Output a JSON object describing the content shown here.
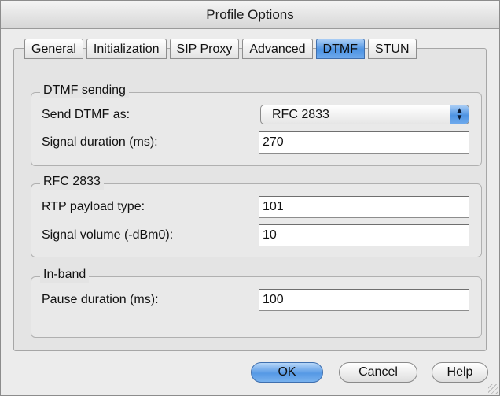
{
  "window": {
    "title": "Profile Options"
  },
  "tabs": [
    {
      "label": "General",
      "active": false
    },
    {
      "label": "Initialization",
      "active": false
    },
    {
      "label": "SIP Proxy",
      "active": false
    },
    {
      "label": "Advanced",
      "active": false
    },
    {
      "label": "DTMF",
      "active": true
    },
    {
      "label": "STUN",
      "active": false
    }
  ],
  "dtmf_sending": {
    "heading": "DTMF sending",
    "send_as_label": "Send DTMF as:",
    "send_as_value": "RFC 2833",
    "signal_duration_label": "Signal duration (ms):",
    "signal_duration_value": "270"
  },
  "rfc2833": {
    "heading": "RFC 2833",
    "payload_type_label": "RTP payload type:",
    "payload_type_value": "101",
    "signal_volume_label": "Signal volume (-dBm0):",
    "signal_volume_value": "10"
  },
  "in_band": {
    "heading": "In-band",
    "pause_duration_label": "Pause duration (ms):",
    "pause_duration_value": "100"
  },
  "buttons": {
    "ok": "OK",
    "cancel": "Cancel",
    "help": "Help"
  },
  "icons": {
    "popup": "up-down-arrows-icon"
  },
  "colors": {
    "accent": "#4d93e3",
    "window_bg": "#ececec"
  }
}
